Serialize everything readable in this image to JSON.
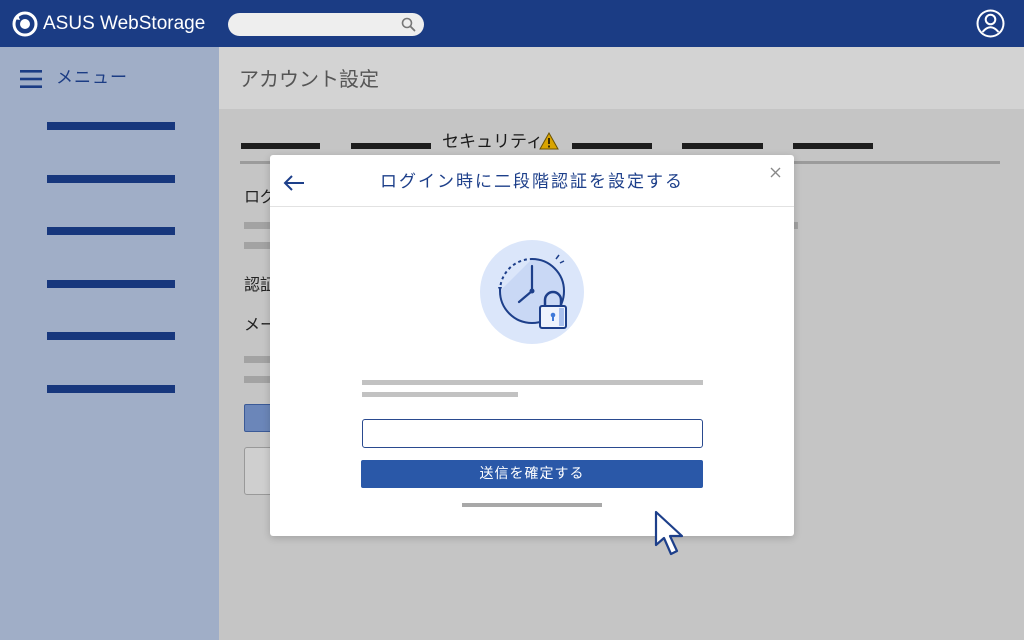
{
  "header": {
    "app_name": "ASUS WebStorage",
    "search_placeholder": ""
  },
  "sidebar": {
    "menu_label": "メニュー",
    "item_count_visual": 6
  },
  "main": {
    "page_title": "アカウント設定",
    "tabs": {
      "active_label": "セキュリティ"
    },
    "background_fragments": {
      "text_1": "ログ",
      "text_2": "認証",
      "text_3": "メー"
    }
  },
  "modal": {
    "title": "ログイン時に二段階認証を設定する",
    "code_input_value": "",
    "confirm_button_label": "送信を確定する"
  },
  "colors": {
    "header_bg": "#1b3c84",
    "sidebar_bg": "#a0aec7",
    "accent": "#2a58a8",
    "warning": "#d9a400"
  },
  "icons": {
    "logo": "asus-webstorage-logo-icon",
    "search": "search-icon",
    "user": "user-icon",
    "menu": "hamburger-menu-icon",
    "warning": "warning-triangle-icon",
    "back": "arrow-left-icon",
    "close": "close-icon",
    "illustration": "clock-lock-icon",
    "cursor": "mouse-pointer-icon"
  }
}
